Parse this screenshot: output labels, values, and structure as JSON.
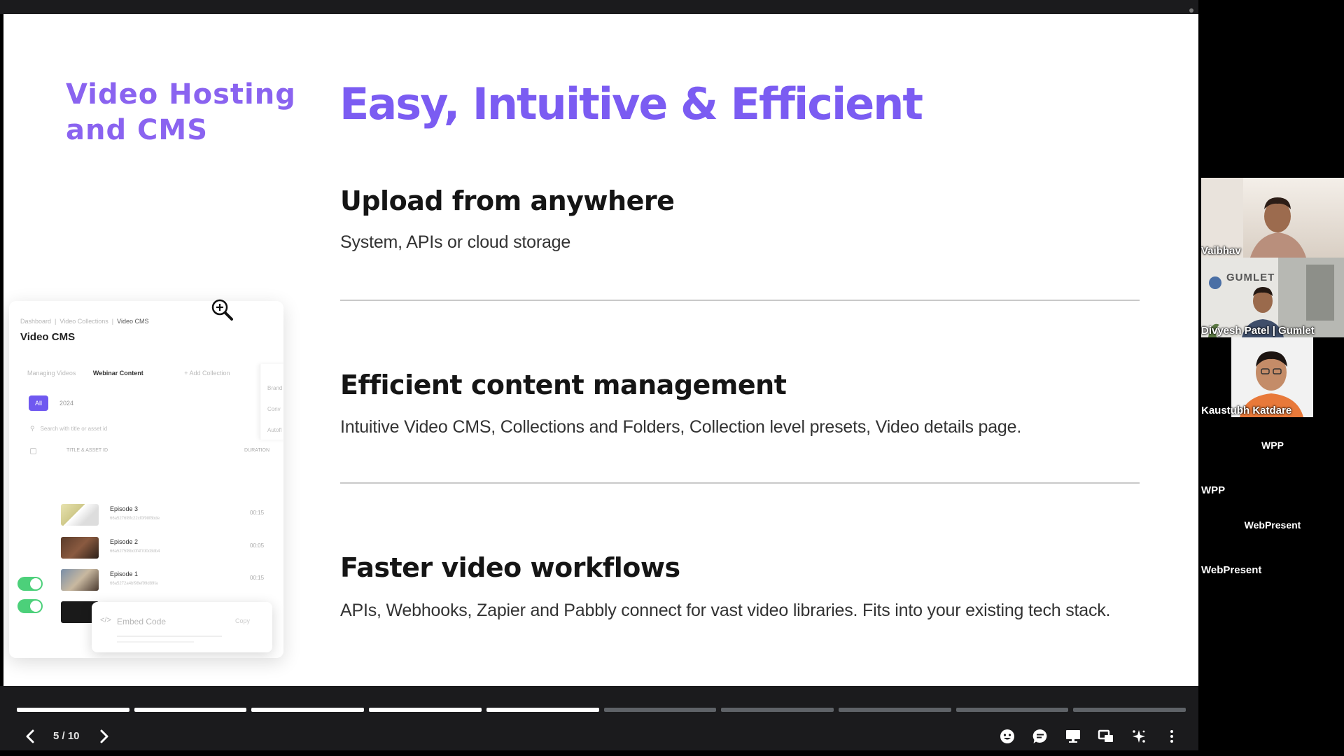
{
  "slide": {
    "section_title": "Video Hosting and CMS",
    "title": "Easy, Intuitive & Efficient",
    "features": [
      {
        "heading": "Upload from anywhere",
        "description": "System, APIs or cloud storage"
      },
      {
        "heading": "Efficient content management",
        "description": "Intuitive Video CMS, Collections and Folders, Collection level presets, Video details page."
      },
      {
        "heading": "Faster video workflows",
        "description": "APIs, Webhooks, Zapier and Pabbly connect for vast video libraries. Fits into your existing tech stack."
      }
    ],
    "cms_mock": {
      "breadcrumb": [
        "Dashboard",
        "Video Collections",
        "Video CMS"
      ],
      "title": "Video CMS",
      "tabs": [
        "Managing Videos",
        "Webinar Content",
        "+ Add Collection"
      ],
      "side_items": [
        "Brand",
        "Conv",
        "Autofl"
      ],
      "filter_pill": "All",
      "filter_year": "2024",
      "search_placeholder": "Search with title or asset id",
      "columns": {
        "title": "TITLE & ASSET ID",
        "duration": "DURATION"
      },
      "rows": [
        {
          "title": "Episode 3",
          "asset_id": "66a5276f8fc22cf0f98f8bde",
          "duration": "00:15"
        },
        {
          "title": "Episode 2",
          "asset_id": "66a5275f8bc0f4f7d0d3db4",
          "duration": "00:05"
        },
        {
          "title": "Episode 1",
          "asset_id": "66a5272a4bf98ef99d89fa",
          "duration": "00:15"
        }
      ],
      "embed_label": "Embed Code",
      "embed_copy": "Copy"
    }
  },
  "player": {
    "page_indicator": "5 / 10",
    "current_page": 5,
    "total_pages": 10
  },
  "participants": [
    {
      "name": "Vaibhav"
    },
    {
      "name": "Divyesh Patel | Gumlet",
      "background_logo": "GUMLET"
    },
    {
      "name": "Kaustubh Katdare"
    },
    {
      "name": "WPP",
      "center_label": "WPP"
    },
    {
      "name": "WebPresent",
      "center_label": "WebPresent"
    }
  ],
  "colors": {
    "accent_purple": "#7b5cf2",
    "controls_bg": "#1b1b1d",
    "toggle_green": "#4cd07a"
  },
  "icons": [
    "zoom-in-icon",
    "chevron-left-icon",
    "chevron-right-icon",
    "emoji-icon",
    "chat-icon",
    "present-icon",
    "window-icon",
    "effects-icon",
    "more-icon"
  ]
}
